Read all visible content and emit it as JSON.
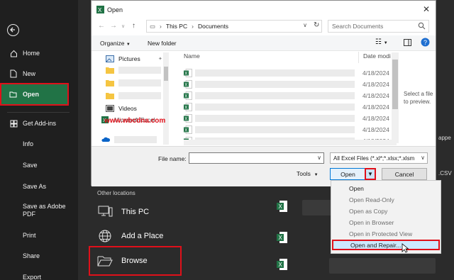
{
  "rail": {
    "items": [
      {
        "label": "Home"
      },
      {
        "label": "New"
      },
      {
        "label": "Open"
      },
      {
        "label": "Get Add-ins"
      },
      {
        "label": "Info"
      },
      {
        "label": "Save"
      },
      {
        "label": "Save As"
      },
      {
        "label": "Save as Adobe PDF"
      },
      {
        "label": "Print"
      },
      {
        "label": "Share"
      },
      {
        "label": "Export"
      }
    ]
  },
  "main": {
    "other_locations_title": "Other locations",
    "locations": [
      {
        "label": "This PC",
        "icon": "computer-icon"
      },
      {
        "label": "Add a Place",
        "icon": "globe-icon"
      },
      {
        "label": "Browse",
        "icon": "folder-icon"
      }
    ],
    "right_text_1": "appe",
    "right_text_2": ".CSV"
  },
  "dialog": {
    "title": "Open",
    "close_label": "✕",
    "breadcrumb": [
      "This PC",
      "Documents"
    ],
    "search_placeholder": "Search Documents",
    "organize_label": "Organize",
    "new_folder_label": "New folder",
    "tree": [
      "Pictures",
      "Videos",
      "Microsoft Excel"
    ],
    "columns": {
      "name": "Name",
      "date": "Date modi"
    },
    "files": [
      {
        "date": "4/18/2024"
      },
      {
        "date": "4/18/2024"
      },
      {
        "date": "4/18/2024"
      },
      {
        "date": "4/18/2024"
      },
      {
        "date": "4/18/2024"
      },
      {
        "date": "4/18/2024"
      },
      {
        "date": "4/18/2024"
      }
    ],
    "preview_text": "Select a file to preview.",
    "watermark": "www.wbcdna.com",
    "file_name_label": "File name:",
    "file_name_value": "",
    "filter_value": "All Excel Files (*.xl*;*.xlsx;*.xlsm",
    "tools_label": "Tools",
    "open_label": "Open",
    "cancel_label": "Cancel"
  },
  "menu": {
    "items": [
      "Open",
      "Open Read-Only",
      "Open as Copy",
      "Open in Browser",
      "Open in Protected View",
      "Open and Repair..."
    ]
  },
  "colors": {
    "excel_green": "#217346",
    "highlight_red": "#e0101a",
    "selection_blue": "#cce8ff"
  }
}
